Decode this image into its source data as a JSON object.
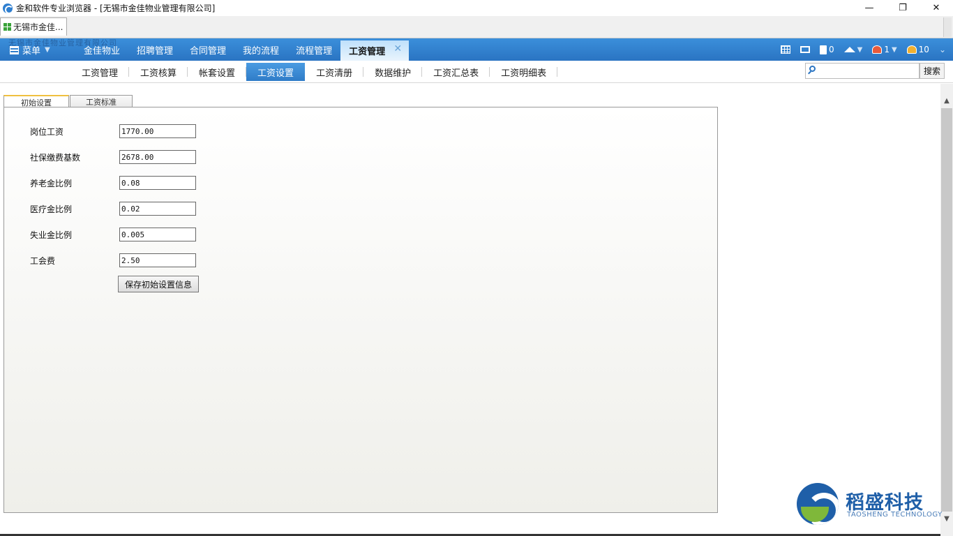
{
  "window": {
    "title": "金和软件专业浏览器 - [无锡市金佳物业管理有限公司]",
    "controls": [
      "—",
      "❐",
      "✕"
    ]
  },
  "browser_tab": {
    "label": "无锡市金佳..."
  },
  "app_nav": {
    "watermark": "无锡市金佳物业管理有限公司",
    "menu_label": "菜单",
    "items": [
      "金佳物业",
      "招聘管理",
      "合同管理",
      "我的流程",
      "流程管理"
    ],
    "active_item": "工资管理",
    "close_glyph": "✕",
    "right": {
      "doc_count": "0",
      "user_count": "1",
      "people_count": "10"
    }
  },
  "sub_nav": {
    "items": [
      "工资管理",
      "工资核算",
      "帐套设置",
      "工资设置",
      "工资清册",
      "数据维护",
      "工资汇总表",
      "工资明细表"
    ],
    "active_index": 3,
    "search_placeholder": "",
    "search_button": "搜索"
  },
  "inner_tabs": [
    "初始设置",
    "工资标准"
  ],
  "form": {
    "fields": [
      {
        "label": "岗位工资",
        "value": "1770.00"
      },
      {
        "label": "社保缴费基数",
        "value": "2678.00"
      },
      {
        "label": "养老金比例",
        "value": "0.08"
      },
      {
        "label": "医疗金比例",
        "value": "0.02"
      },
      {
        "label": "失业金比例",
        "value": "0.005"
      },
      {
        "label": "工会费",
        "value": "2.50"
      }
    ],
    "save_button": "保存初始设置信息"
  },
  "logo": {
    "cn": "稻盛科技",
    "en": "TAOSHENG TECHNOLOGY"
  },
  "colors": {
    "nav_blue": "#2a74c2",
    "active_tab_top": "#f0c040",
    "logo_blue": "#1f5fa8",
    "logo_green": "#7fb83a"
  }
}
